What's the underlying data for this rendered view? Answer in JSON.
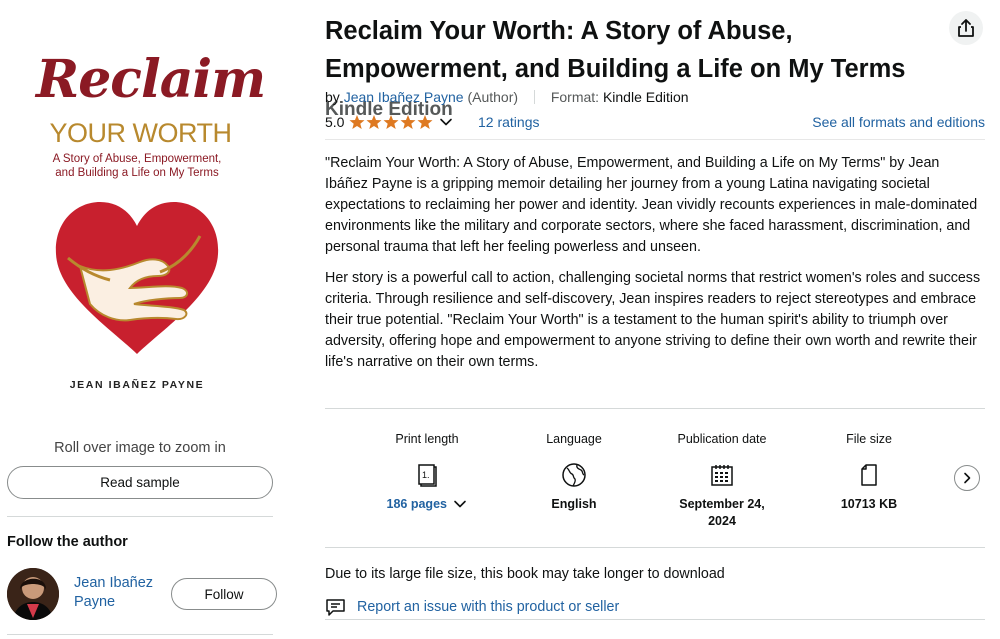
{
  "cover": {
    "title_script": "Reclaim",
    "title_caps": "YOUR WORTH",
    "subtitle_line1": "A Story of Abuse, Empowerment,",
    "subtitle_line2": "and Building a Life on My Terms",
    "author": "JEAN IBAÑEZ PAYNE",
    "colors": {
      "crimson": "#8B1A24",
      "gold": "#B8892E",
      "heart_red": "#C8202E"
    }
  },
  "left": {
    "rollover_text": "Roll over image to zoom in",
    "read_sample_label": "Read sample",
    "follow_heading": "Follow the author",
    "author_name": "Jean Ibañez Payne",
    "follow_label": "Follow"
  },
  "product": {
    "title": "Reclaim Your Worth: A Story of Abuse, Empowerment, and Building a Life on My Terms",
    "edition": "Kindle Edition",
    "by_prefix": "by",
    "author_link": "Jean Ibañez Payne",
    "author_role": "(Author)",
    "format_label": "Format:",
    "format_value": "Kindle Edition",
    "rating_value": "5.0",
    "rating_stars": 5,
    "ratings_count": "12 ratings",
    "all_formats_link": "See all formats and editions",
    "share_icon": "share-icon"
  },
  "description": {
    "p1": "\"Reclaim Your Worth: A Story of Abuse, Empowerment, and Building a Life on My Terms\" by Jean Ibáñez Payne is a gripping memoir detailing her journey from a young Latina navigating societal expectations to reclaiming her power and identity. Jean vividly recounts experiences in male-dominated environments like the military and corporate sectors, where she faced harassment, discrimination, and personal trauma that left her feeling powerless and unseen.",
    "p2": "Her story is a powerful call to action, challenging societal norms that restrict women's roles and success criteria. Through resilience and self-discovery, Jean inspires readers to reject stereotypes and embrace their true potential. \"Reclaim Your Worth\" is a testament to the human spirit's ability to triumph over adversity, offering hope and empowerment to anyone striving to define their own worth and rewrite their life's narrative on their own terms."
  },
  "details": [
    {
      "label": "Print length",
      "icon": "book-pages-icon",
      "value": "186 pages",
      "has_dropdown": true
    },
    {
      "label": "Language",
      "icon": "globe-icon",
      "value": "English"
    },
    {
      "label": "Publication date",
      "icon": "calendar-icon",
      "value_line1": "September 24,",
      "value_line2": "2024"
    },
    {
      "label": "File size",
      "icon": "file-icon",
      "value": "10713 KB"
    }
  ],
  "footer": {
    "large_file_note": "Due to its large file size, this book may take longer to download",
    "report_link": "Report an issue with this product or seller"
  },
  "colors": {
    "link": "#2162A1",
    "star": "#DE7921",
    "text": "#0F1111",
    "muted": "#565959"
  }
}
